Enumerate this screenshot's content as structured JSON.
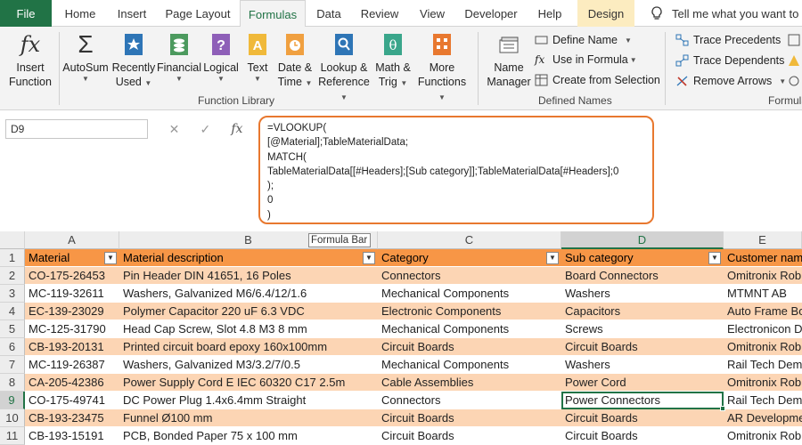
{
  "tabs": {
    "file": "File",
    "items": [
      "Home",
      "Insert",
      "Page Layout",
      "Formulas",
      "Data",
      "Review",
      "View",
      "Developer",
      "Help",
      "Design"
    ],
    "active": "Formulas",
    "tell_me": "Tell me what you want to d"
  },
  "ribbon": {
    "insert_function": [
      "Insert",
      "Function"
    ],
    "autosum": "AutoSum",
    "recently_used": [
      "Recently",
      "Used"
    ],
    "financial": "Financial",
    "logical": "Logical",
    "text": "Text",
    "date_time": [
      "Date &",
      "Time"
    ],
    "lookup_reference": [
      "Lookup &",
      "Reference"
    ],
    "math_trig": [
      "Math &",
      "Trig"
    ],
    "more_functions": [
      "More",
      "Functions"
    ],
    "function_library_label": "Function Library",
    "name_manager": [
      "Name",
      "Manager"
    ],
    "define_name": "Define Name",
    "use_in_formula": "Use in Formula",
    "create_from_selection": "Create from Selection",
    "defined_names_label": "Defined Names",
    "trace_precedents": "Trace Precedents",
    "trace_dependents": "Trace Dependents",
    "remove_arrows": "Remove Arrows",
    "formula_auditing_label": "Formula"
  },
  "formula_bar": {
    "name_box": "D9",
    "fx": "fx",
    "content": "=VLOOKUP(\n[@Material];TableMaterialData;\nMATCH(\nTableMaterialData[[#Headers];[Sub category]];TableMaterialData[#Headers];0\n);\n0\n)",
    "tooltip": "Formula Bar"
  },
  "columns": [
    "A",
    "B",
    "C",
    "D",
    "E"
  ],
  "selected_column": "D",
  "table": {
    "headers": [
      "Material",
      "Material description",
      "Category",
      "Sub category",
      "Customer nam"
    ],
    "rows": [
      [
        "CO-175-26453",
        "Pin Header DIN 41651, 16 Poles",
        "Connectors",
        "Board Connectors",
        "Omitronix Rob"
      ],
      [
        "MC-119-32611",
        "Washers, Galvanized M6/6.4/12/1.6",
        "Mechanical Components",
        "Washers",
        "MTMNT AB"
      ],
      [
        "EC-139-23029",
        "Polymer Capacitor 220 uF 6.3 VDC",
        "Electronic Components",
        "Capacitors",
        "Auto Frame Bo"
      ],
      [
        "MC-125-31790",
        "Head Cap Screw, Slot 4.8 M3 8 mm",
        "Mechanical Components",
        "Screws",
        "Electronicon De"
      ],
      [
        "CB-193-20131",
        "Printed circuit board epoxy 160x100mm",
        "Circuit Boards",
        "Circuit Boards",
        "Omitronix Rob"
      ],
      [
        "MC-119-26387",
        "Washers, Galvanized M3/3.2/7/0.5",
        "Mechanical Components",
        "Washers",
        "Rail Tech Dema"
      ],
      [
        "CA-205-42386",
        "Power Supply Cord E IEC 60320 C17 2.5m",
        "Cable Assemblies",
        "Power Cord",
        "Omitronix Rob"
      ],
      [
        "CO-175-49741",
        "DC Power Plug 1.4x6.4mm Straight",
        "Connectors",
        "Power Connectors",
        "Rail Tech Dema"
      ],
      [
        "CB-193-23475",
        "Funnel Ø100 mm",
        "Circuit Boards",
        "Circuit Boards",
        "AR Developme"
      ],
      [
        "CB-193-15191",
        "PCB, Bonded Paper 75 x 100 mm",
        "Circuit Boards",
        "Circuit Boards",
        "Omitronix Rob"
      ]
    ],
    "row_numbers": [
      "1",
      "2",
      "3",
      "4",
      "5",
      "6",
      "7",
      "8",
      "9",
      "10",
      "11"
    ]
  },
  "selected_row": "9",
  "colors": {
    "accent": "#217346",
    "header": "#f79646",
    "band": "#fcd5b4",
    "highlight": "#e8782f"
  }
}
